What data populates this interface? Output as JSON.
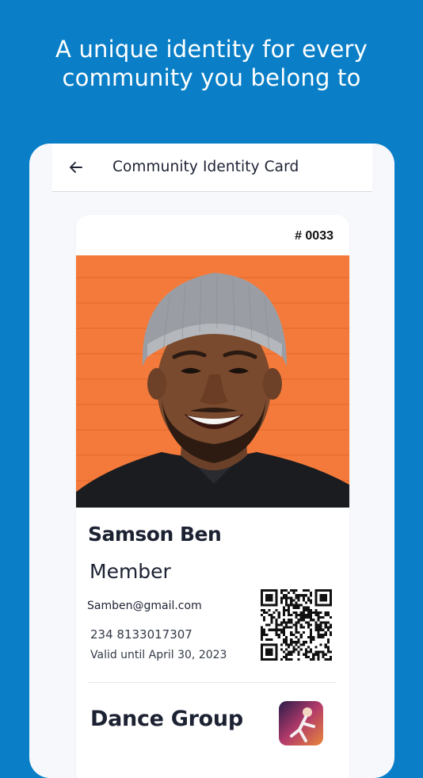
{
  "promo": {
    "line1": "A unique identity for every",
    "line2": "community you belong to"
  },
  "appbar": {
    "title": "Community Identity Card",
    "back_icon": "arrow-left-icon"
  },
  "card": {
    "number": "# 0033",
    "name": "Samson Ben",
    "role": "Member",
    "email": "Samben@gmail.com",
    "phone": "234 8133017307",
    "valid_until": "Valid until April 30, 2023",
    "group": "Dance Group"
  },
  "colors": {
    "background": "#0a7fc7",
    "photo_background": "#f47a3b",
    "text_dark": "#1d2233"
  }
}
